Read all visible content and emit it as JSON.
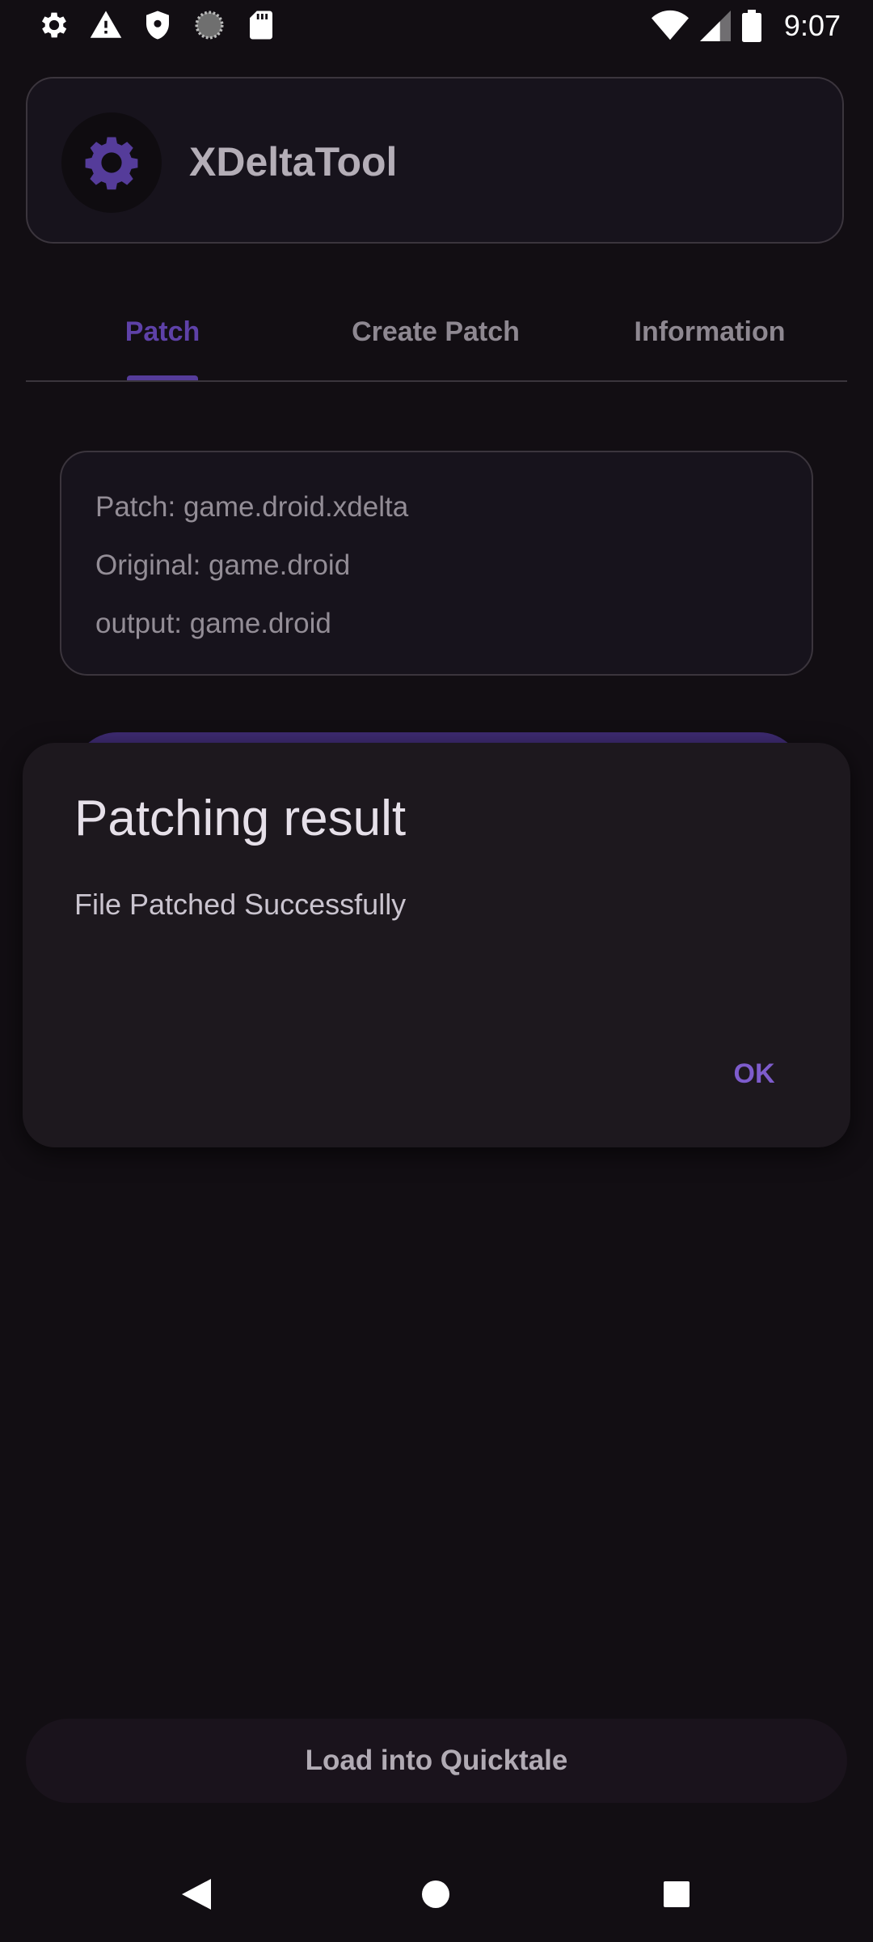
{
  "status_bar": {
    "time": "9:07",
    "left_icons": [
      "settings-icon",
      "warning-icon",
      "shield-icon",
      "loading-icon",
      "sd-card-icon"
    ],
    "right_icons": [
      "wifi-icon",
      "cellular-signal-icon",
      "battery-icon"
    ]
  },
  "header": {
    "app_title": "XDeltaTool",
    "logo_icon": "gear-icon"
  },
  "tabs": [
    {
      "label": "Patch",
      "selected": true
    },
    {
      "label": "Create Patch",
      "selected": false
    },
    {
      "label": "Information",
      "selected": false
    }
  ],
  "info_card": {
    "patch_line": "Patch: game.droid.xdelta",
    "original_line": "Original: game.droid",
    "output_line": "output: game.droid"
  },
  "bottom_button": {
    "label": "Load into Quicktale"
  },
  "dialog": {
    "title": "Patching result",
    "message": "File Patched Successfully",
    "ok_label": "OK"
  },
  "nav_bar": {
    "buttons": [
      "back-icon",
      "home-icon",
      "recents-icon"
    ]
  },
  "colors": {
    "accent": "#7e5ccd",
    "background": "#120e13",
    "dialog_surface": "#1d181e"
  }
}
